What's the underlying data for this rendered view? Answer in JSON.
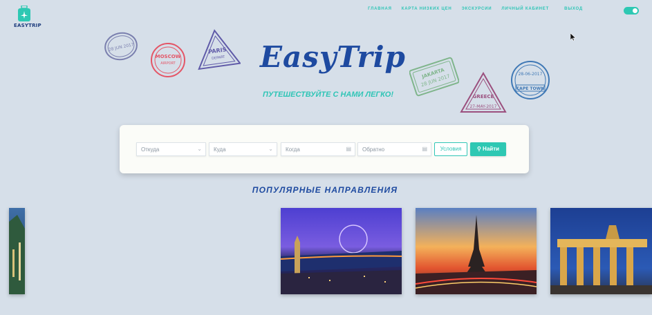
{
  "logo": {
    "text": "EASYTRIP"
  },
  "nav": {
    "items": [
      {
        "label": "Главная"
      },
      {
        "label": "Карта низких цен"
      },
      {
        "label": "Экскурсии"
      },
      {
        "label": "Личный кабинет"
      },
      {
        "label": "Выход"
      }
    ]
  },
  "hero": {
    "title": "EasyTrip",
    "subtitle": "Путешествуйте с нами легко!"
  },
  "stamps": [
    {
      "line1": "28 JUN 2017"
    },
    {
      "line1": "MOSCOW",
      "line2": "AIRPORT"
    },
    {
      "line1": "PARIS",
      "line2": "DEPART"
    },
    {
      "line1": "JAKARTA",
      "line2": "28 JUN 2017"
    },
    {
      "line1": "GREECE",
      "line2": "27-MAY-2017"
    },
    {
      "line1": "CAPE TOWN",
      "line2": "28-06-2017"
    }
  ],
  "search": {
    "from_placeholder": "Откуда",
    "to_placeholder": "Куда",
    "when_placeholder": "Когда",
    "back_placeholder": "Обратно",
    "conditions_label": "Условия",
    "find_label": "Найти"
  },
  "popular": {
    "title": "Популярные направления"
  },
  "colors": {
    "accent": "#2ec8b3",
    "brand": "#1e4aa0",
    "background": "#d6dfe9"
  },
  "icons": [
    "logo-bag-icon",
    "chevron-down-icon",
    "calendar-icon",
    "search-icon",
    "cursor-icon"
  ]
}
